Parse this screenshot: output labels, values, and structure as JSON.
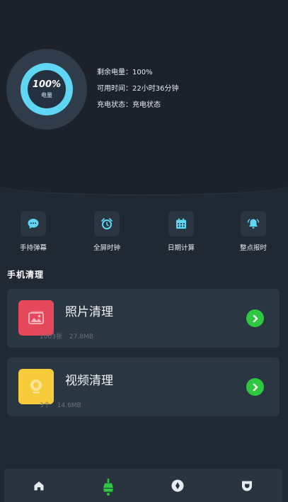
{
  "battery": {
    "percent": "100%",
    "gauge_label": "电量",
    "level": 1.0,
    "remaining": "剩余电量：100%",
    "available_time": "可用时间：22小时36分钟",
    "charge_status": "充电状态：充电状态"
  },
  "features": [
    {
      "label": "手持弹幕",
      "icon": "chat-bubble-icon"
    },
    {
      "label": "全屏时钟",
      "icon": "alarm-clock-icon"
    },
    {
      "label": "日期计算",
      "icon": "calendar-icon"
    },
    {
      "label": "整点报时",
      "icon": "bell-icon"
    }
  ],
  "section_title": "手机清理",
  "cards": [
    {
      "title": "照片清理",
      "count": "1003张",
      "size": "27.8MB",
      "thumb_color": "#e5485a",
      "icon": "photo-icon"
    },
    {
      "title": "视频清理",
      "count": "3个",
      "size": "14.6MB",
      "thumb_color": "#f7cc3b",
      "icon": "video-icon"
    }
  ],
  "tabs": [
    {
      "icon": "home-icon",
      "active": false
    },
    {
      "icon": "broom-icon",
      "active": true
    },
    {
      "icon": "compass-icon",
      "active": false
    },
    {
      "icon": "profile-icon",
      "active": false
    }
  ],
  "colors": {
    "accent": "#2ec840",
    "gauge": "#5fd6f3",
    "background": "#1f2833"
  }
}
